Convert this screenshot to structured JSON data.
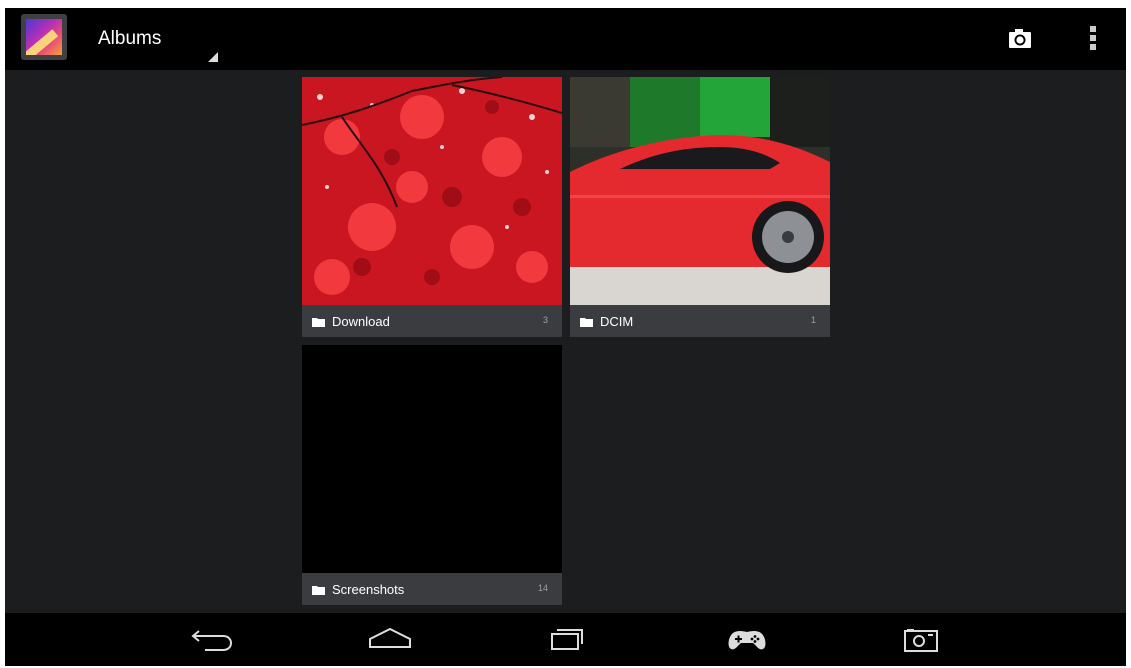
{
  "action_bar": {
    "title": "Albums",
    "app_icon": "gallery-icon",
    "actions": [
      {
        "name": "camera",
        "icon": "camera-icon"
      },
      {
        "name": "more",
        "icon": "overflow-menu-icon"
      }
    ]
  },
  "albums": [
    {
      "name": "Download",
      "count": "3",
      "thumbnail": "red-autumn-leaves-photo"
    },
    {
      "name": "DCIM",
      "count": "1",
      "thumbnail": "red-car-photo"
    },
    {
      "name": "Screenshots",
      "count": "14",
      "thumbnail": "black-screenshot"
    }
  ],
  "nav_bar": {
    "buttons": [
      "back-icon",
      "home-icon",
      "recent-apps-icon",
      "gamepad-icon",
      "screenshot-icon"
    ]
  },
  "colors": {
    "background": "#1b1d1f",
    "bar": "#000000",
    "label_bar": "#3a3c3f",
    "text": "#ffffff",
    "muted_text": "#9da0a3"
  }
}
